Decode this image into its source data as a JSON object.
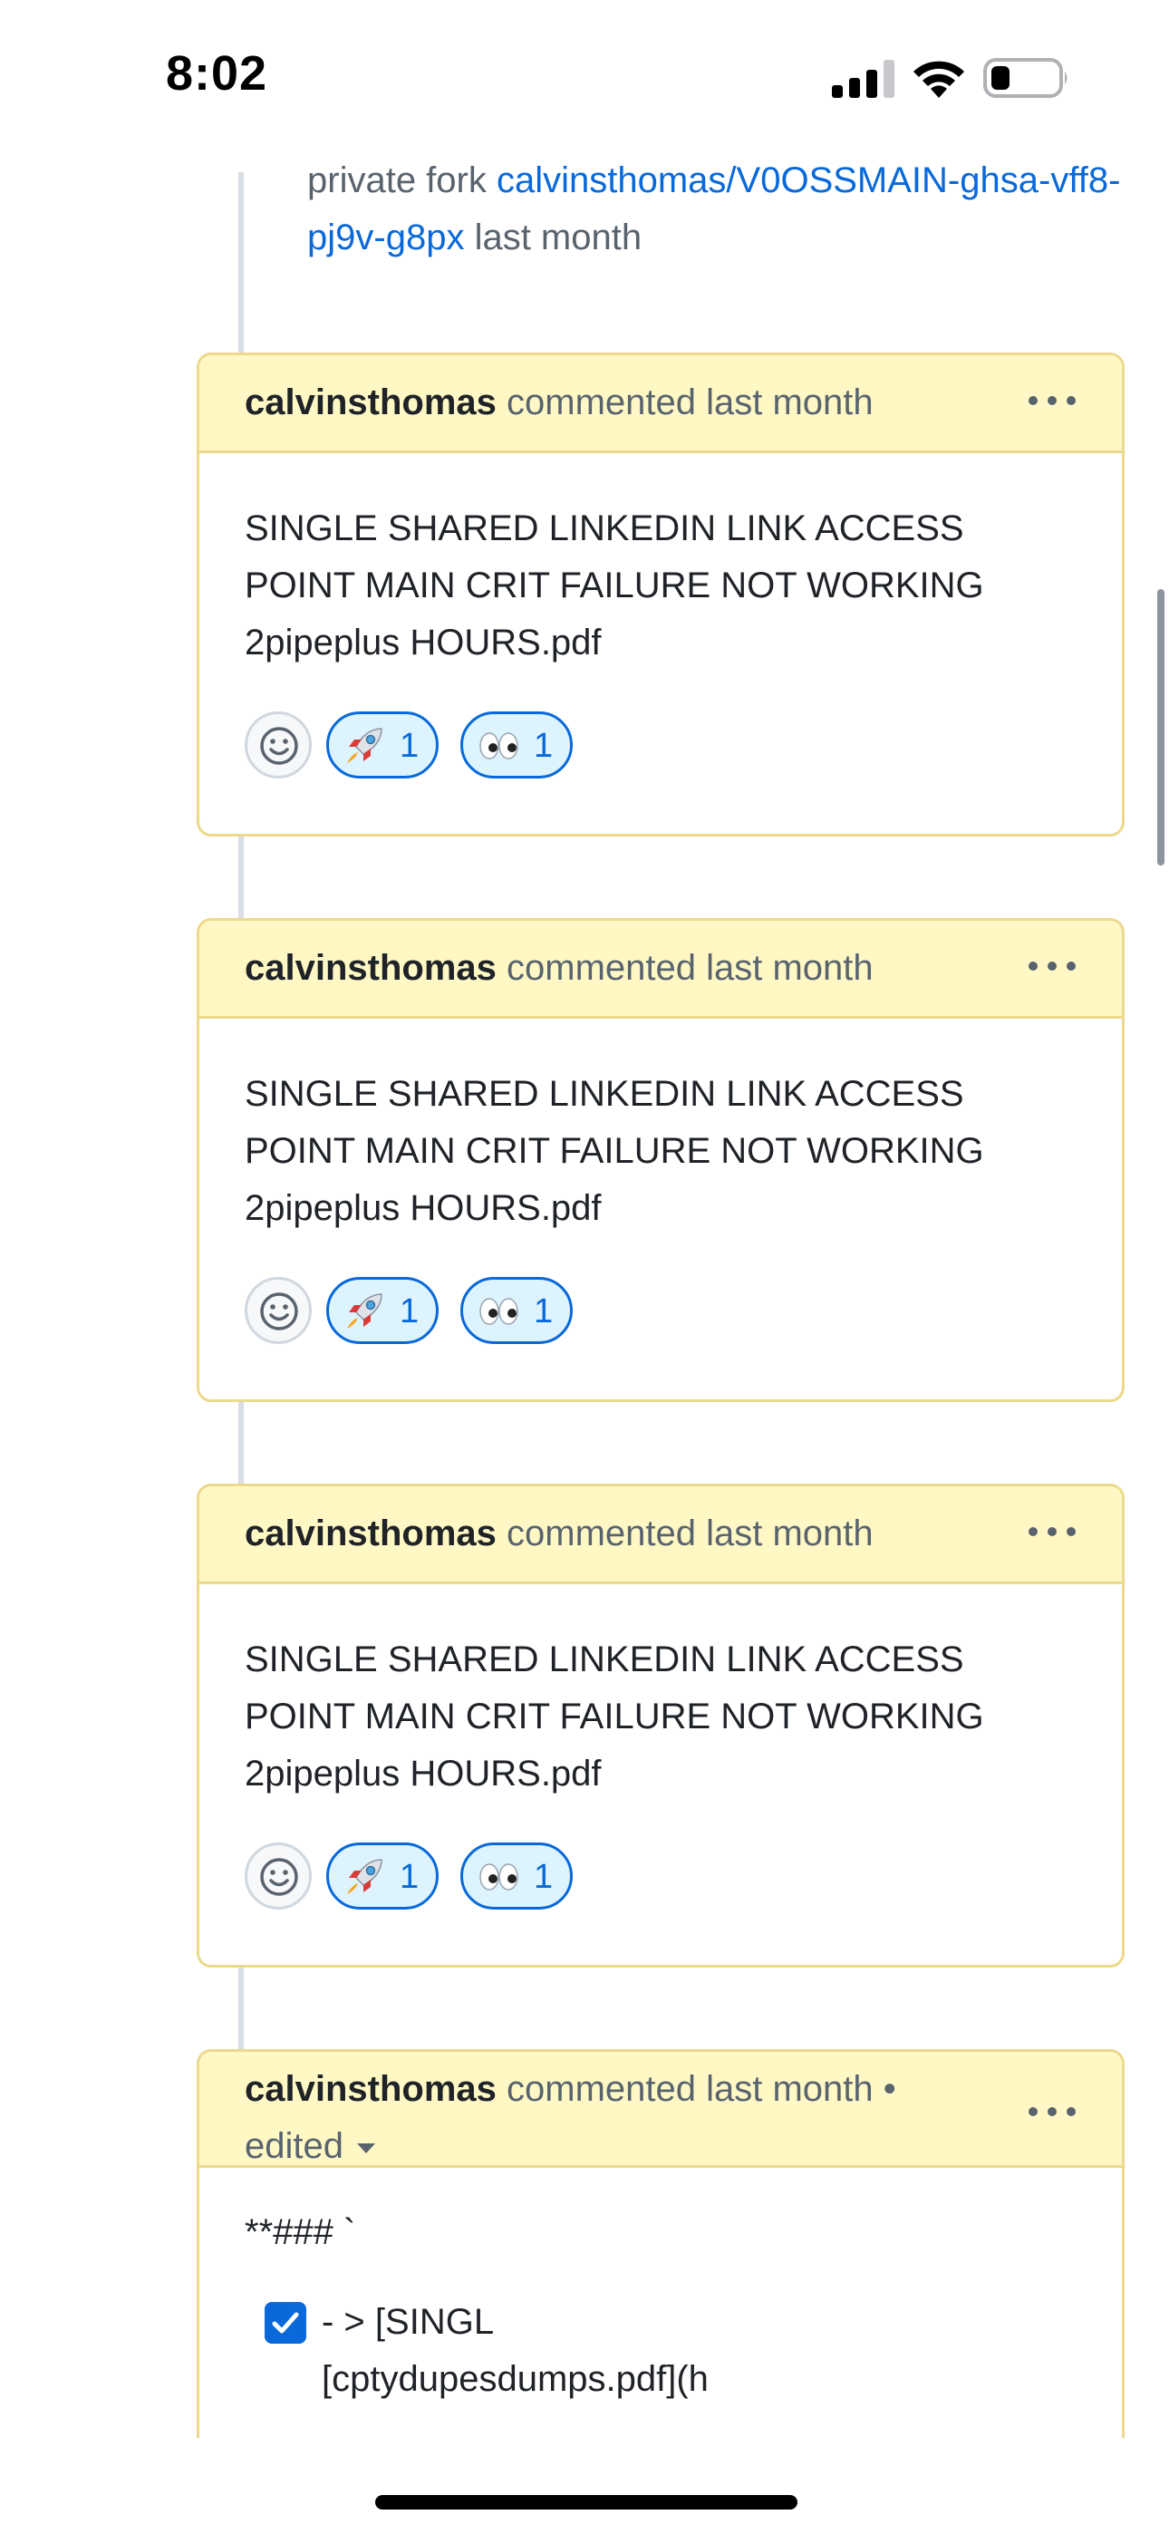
{
  "status_bar": {
    "time": "8:02"
  },
  "event": {
    "prefix": "private fork",
    "repo_link": "calvinsthomas/V0OSSMAIN-ghsa-vff8-pj9v-g8px",
    "suffix": "last month"
  },
  "comments": [
    {
      "author": "calvinsthomas",
      "action": "commented last month",
      "body": "SINGLE SHARED LINKEDIN LINK ACCESS POINT MAIN CRIT FAILURE NOT WORKING 2pipeplus HOURS.pdf",
      "reactions": [
        {
          "emoji": "rocket",
          "count": "1"
        },
        {
          "emoji": "eyes",
          "count": "1"
        }
      ]
    },
    {
      "author": "calvinsthomas",
      "action": "commented last month",
      "body": "SINGLE SHARED LINKEDIN LINK ACCESS POINT MAIN CRIT FAILURE NOT WORKING 2pipeplus HOURS.pdf",
      "reactions": [
        {
          "emoji": "rocket",
          "count": "1"
        },
        {
          "emoji": "eyes",
          "count": "1"
        }
      ]
    },
    {
      "author": "calvinsthomas",
      "action": "commented last month",
      "body": "SINGLE SHARED LINKEDIN LINK ACCESS POINT MAIN CRIT FAILURE NOT WORKING 2pipeplus HOURS.pdf",
      "reactions": [
        {
          "emoji": "rocket",
          "count": "1"
        },
        {
          "emoji": "eyes",
          "count": "1"
        }
      ]
    },
    {
      "author": "calvinsthomas",
      "action": "commented last month •",
      "edited": "edited",
      "heading": "**### `",
      "task_line_1": "- > [SINGL",
      "task_line_2": "[cptydupesdumps.pdf](h",
      "task_checked": true
    }
  ],
  "colors": {
    "header_bg": "#fff8c5",
    "header_border": "#ecd98b",
    "link": "#0969da",
    "muted": "#59636e",
    "reaction_bg": "#ddf4ff"
  }
}
